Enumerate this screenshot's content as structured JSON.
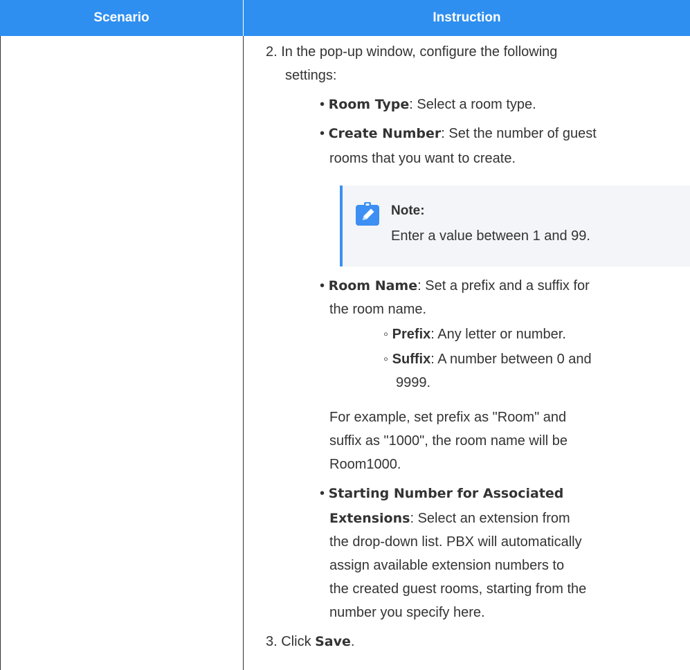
{
  "table": {
    "header": {
      "scenario": "Scenario",
      "instruction": "Instruction"
    }
  },
  "instruction": {
    "step2": {
      "line1": "2. In the pop-up window, configure the following",
      "line2": "settings:"
    },
    "room_type": {
      "label": "Room Type",
      "text": ": Select a room type."
    },
    "create_number": {
      "label": "Create Number",
      "text1": ": Set the number of guest",
      "text2": "rooms that you want to create."
    },
    "note": {
      "title": "Note:",
      "body": "Enter a value between 1 and 99."
    },
    "room_name": {
      "label": "Room Name",
      "text1": ": Set a prefix and a suffix for",
      "text2": "the room name.",
      "prefix_label": "Prefix",
      "prefix_text": ": Any letter or number.",
      "suffix_label": "Suffix",
      "suffix_text1": ": A number between 0 and",
      "suffix_text2": "9999.",
      "example1": "For example, set prefix as \"Room\" and",
      "example2": "suffix as \"1000\", the room name will be",
      "example3": "Room1000."
    },
    "starting_number": {
      "label1": "Starting Number for Associated",
      "label2": "Extensions",
      "text1": ": Select an extension from",
      "text2": "the drop-down list. PBX will automatically",
      "text3": "assign available extension numbers to",
      "text4": "the created guest rooms, starting from the",
      "text5": "number you specify here."
    },
    "step3": {
      "prefix": "3. Click ",
      "button": "Save",
      "suffix": "."
    }
  },
  "colors": {
    "header_bg": "#2e8ff0",
    "header_text": "#ffffff",
    "note_bg": "#f3f5f8",
    "note_accent": "#3d8ff3",
    "text": "#333333"
  },
  "icons": {
    "note": "pencil-edit-icon"
  }
}
